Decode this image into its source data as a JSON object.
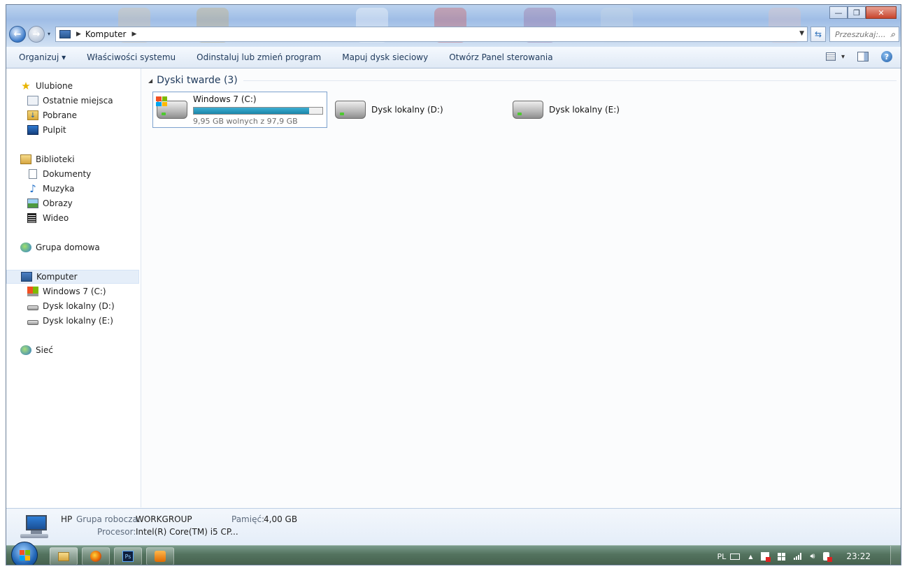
{
  "window": {
    "caption_minimize": "—",
    "caption_restore": "❐",
    "caption_close": "✕"
  },
  "nav": {
    "back_glyph": "←",
    "forward_glyph": "→",
    "recent_glyph": "▾",
    "breadcrumb_sep": "▶",
    "breadcrumb_location": "Komputer",
    "breadcrumb_after": "▶",
    "address_dropdown": "▼",
    "refresh_glyph": "⇆",
    "search_placeholder": "Przeszukaj:...",
    "search_glyph": "⌕"
  },
  "toolbar": {
    "organize": "Organizuj ▾",
    "system_properties": "Właściwości systemu",
    "uninstall_program": "Odinstaluj lub zmień program",
    "map_network_drive": "Mapuj dysk sieciowy",
    "open_control_panel": "Otwórz Panel sterowania",
    "view_dropdown": "▾",
    "help": "?"
  },
  "sidebar": {
    "favorites": "Ulubione",
    "recent_places": "Ostatnie miejsca",
    "downloads": "Pobrane",
    "desktop": "Pulpit",
    "libraries": "Biblioteki",
    "documents": "Dokumenty",
    "music": "Muzyka",
    "pictures": "Obrazy",
    "videos": "Wideo",
    "homegroup": "Grupa domowa",
    "computer": "Komputer",
    "drive_c": "Windows 7 (C:)",
    "drive_d": "Dysk lokalny (D:)",
    "drive_e": "Dysk lokalny (E:)",
    "network": "Sieć"
  },
  "content": {
    "group_toggle": "◢",
    "group_title": "Dyski twarde (3)",
    "drives": [
      {
        "name": "Windows 7 (C:)",
        "free_text": "9,95 GB wolnych z 97,9 GB",
        "used_fraction": 0.898
      },
      {
        "name": "Dysk lokalny (D:)"
      },
      {
        "name": "Dysk lokalny (E:)"
      }
    ]
  },
  "details": {
    "computer_name": "HP",
    "workgroup_label": "Grupa robocza:",
    "workgroup_value": "WORKGROUP",
    "memory_label": "Pamięć:",
    "memory_value": "4,00 GB",
    "processor_label": "Procesor:",
    "processor_value": "Intel(R) Core(TM) i5 CP..."
  },
  "taskbar": {
    "language": "PL",
    "tray_expand": "▲",
    "clock": "23:22"
  },
  "colors": {
    "accent": "#1e395b",
    "progress": "#1b86a9"
  }
}
